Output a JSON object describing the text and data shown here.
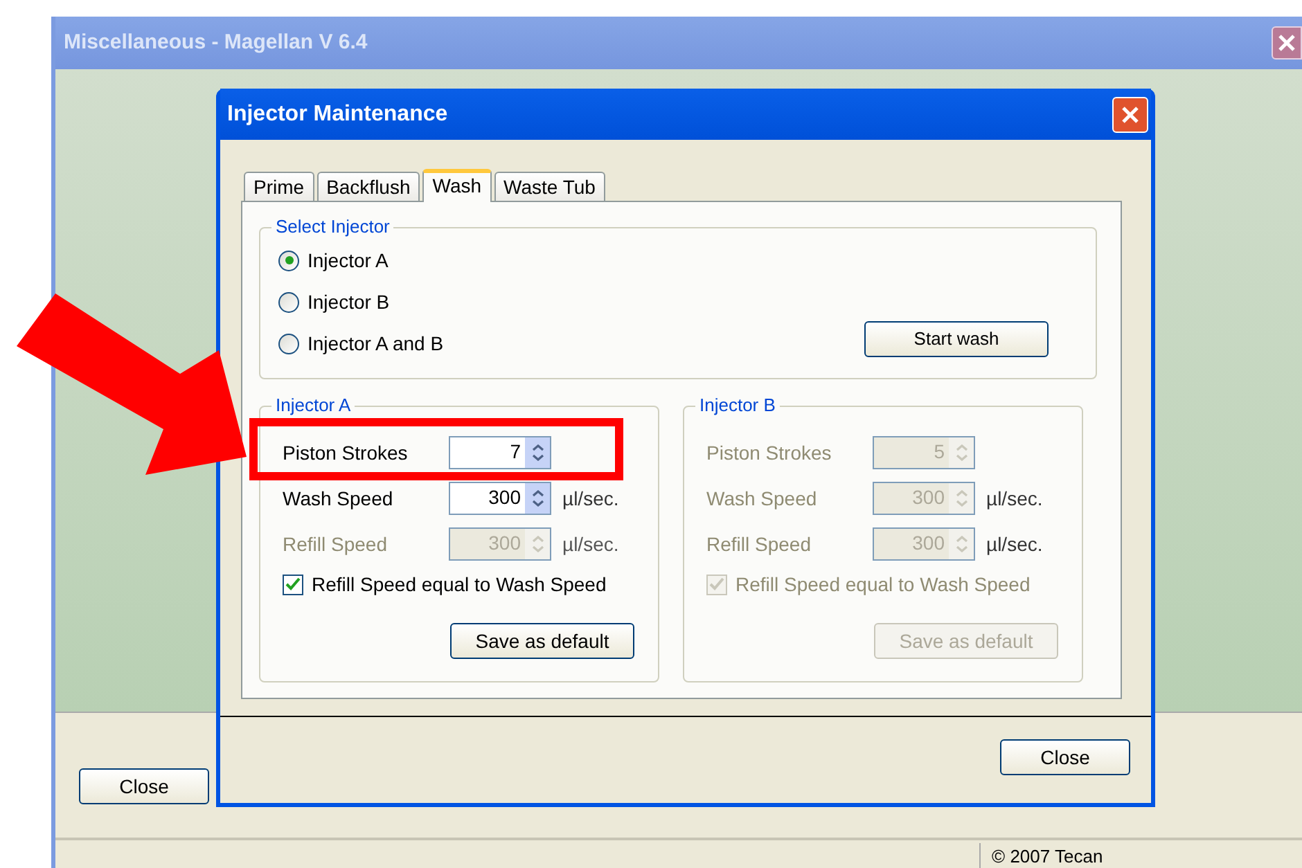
{
  "main_window": {
    "title": "Miscellaneous - Magellan V 6.4",
    "close_button": "Close",
    "status_text": "© 2007 Tecan"
  },
  "dialog": {
    "title": "Injector Maintenance",
    "tabs": [
      {
        "label": "Prime",
        "selected": false
      },
      {
        "label": "Backflush",
        "selected": false
      },
      {
        "label": "Wash",
        "selected": true
      },
      {
        "label": "Waste Tub",
        "selected": false
      }
    ],
    "select_injector": {
      "legend": "Select Injector",
      "options": [
        {
          "label": "Injector A",
          "selected": true
        },
        {
          "label": "Injector B",
          "selected": false
        },
        {
          "label": "Injector A and B",
          "selected": false
        }
      ],
      "start_button": "Start wash"
    },
    "injector_panels": [
      {
        "legend": "Injector A",
        "fields": [
          {
            "label": "Piston Strokes",
            "value": "7",
            "disabled": false
          },
          {
            "label": "Wash Speed",
            "value": "300",
            "unit": "µl/sec.",
            "disabled": false
          },
          {
            "label": "Refill Speed",
            "value": "300",
            "unit": "µl/sec.",
            "disabled": true
          }
        ],
        "checkbox": {
          "label": "Refill Speed equal to Wash Speed",
          "checked": true,
          "disabled": false
        },
        "save_button": {
          "label": "Save as default",
          "disabled": false
        }
      },
      {
        "legend": "Injector B",
        "fields": [
          {
            "label": "Piston Strokes",
            "value": "5",
            "disabled": true
          },
          {
            "label": "Wash Speed",
            "value": "300",
            "unit": "µl/sec.",
            "disabled": true
          },
          {
            "label": "Refill Speed",
            "value": "300",
            "unit": "µl/sec.",
            "disabled": true
          }
        ],
        "checkbox": {
          "label": "Refill Speed equal to Wash Speed",
          "checked": true,
          "disabled": true
        },
        "save_button": {
          "label": "Save as default",
          "disabled": true
        }
      }
    ],
    "close_button": "Close"
  }
}
